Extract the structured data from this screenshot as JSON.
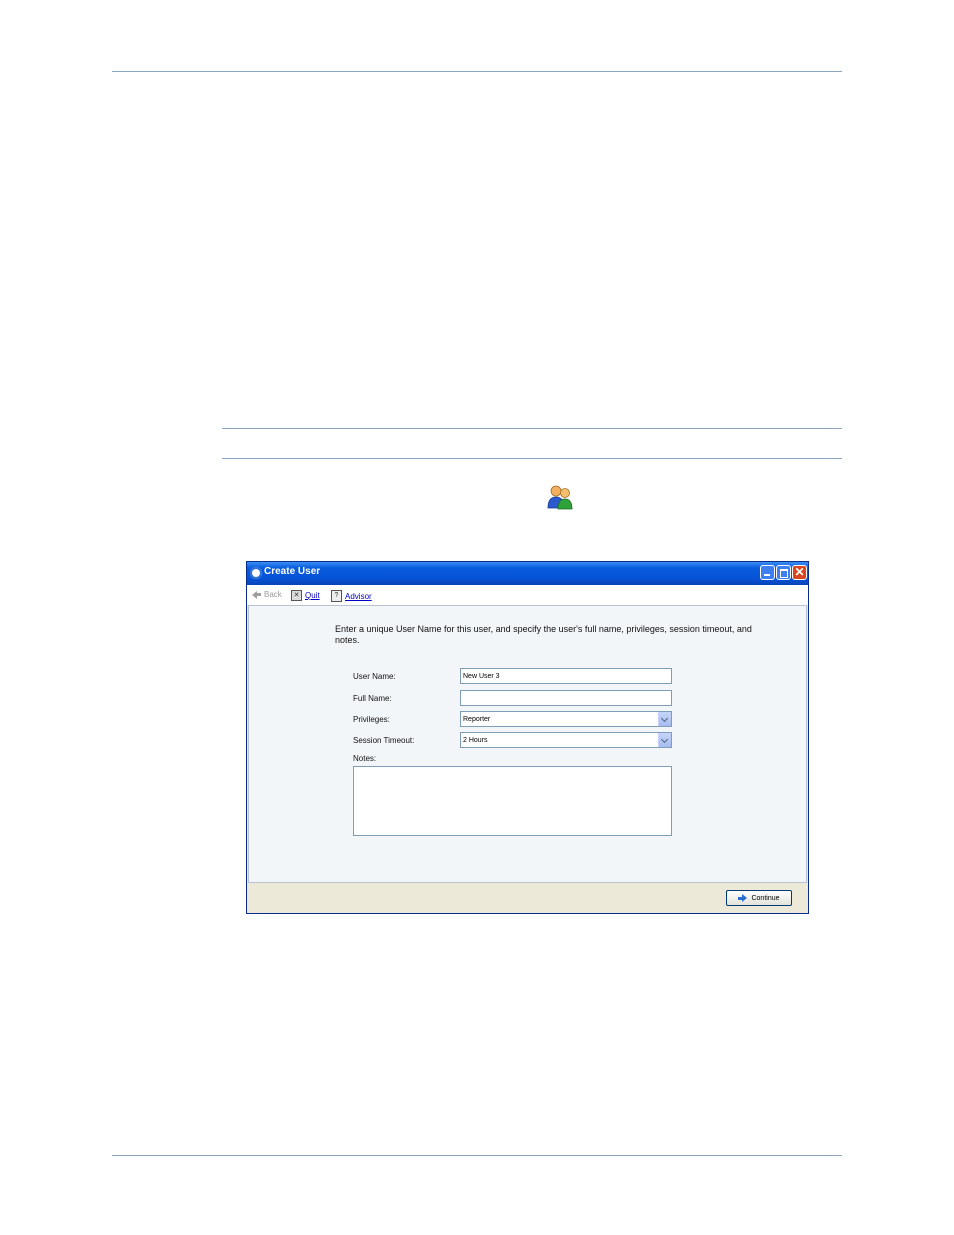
{
  "dialog": {
    "title": "Create User",
    "toolbar": {
      "back": "Back",
      "quit": "Quit",
      "advisor": "Advisor"
    },
    "intro": "Enter a unique User Name for this user, and specify the user's full name, privileges, session timeout, and notes.",
    "fields": {
      "user_name_label": "User Name:",
      "user_name_value": "New User 3",
      "full_name_label": "Full Name:",
      "full_name_value": "",
      "privileges_label": "Privileges:",
      "privileges_value": "Reporter",
      "session_timeout_label": "Session Timeout:",
      "session_timeout_value": "2 Hours",
      "notes_label": "Notes:"
    },
    "continue_label": "Continue"
  }
}
